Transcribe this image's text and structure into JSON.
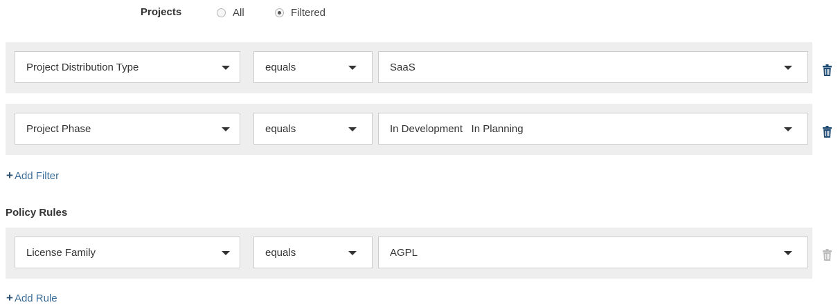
{
  "projects": {
    "label": "Projects",
    "options": [
      {
        "label": "All",
        "selected": false
      },
      {
        "label": "Filtered",
        "selected": true
      }
    ]
  },
  "filters": [
    {
      "field": "Project Distribution Type",
      "operator": "equals",
      "value": "SaaS"
    },
    {
      "field": "Project Phase",
      "operator": "equals",
      "value": "In Development   In Planning"
    }
  ],
  "add_filter_label": "Add Filter",
  "policy_rules": {
    "title": "Policy Rules",
    "rules": [
      {
        "field": "License Family",
        "operator": "equals",
        "value": "AGPL"
      }
    ],
    "add_rule_label": "Add Rule"
  },
  "icons": {
    "delete": "trash-icon",
    "dropdown": "caret-down-icon",
    "add": "plus-icon"
  },
  "colors": {
    "block_background": "#eeeeee",
    "trash_active": "#1f4b73",
    "trash_disabled": "#bbbbbb",
    "link": "#3a6d99"
  }
}
